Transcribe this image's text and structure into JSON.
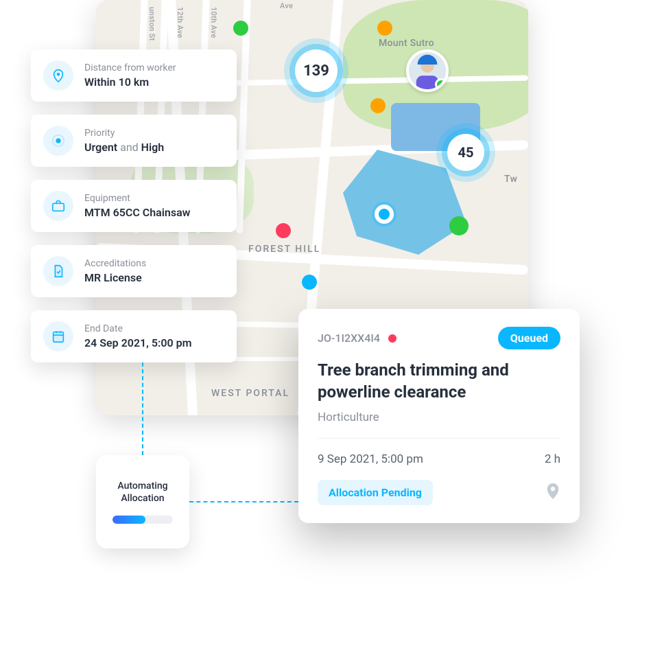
{
  "map": {
    "labels": {
      "sutro": "Mount Sutro",
      "forest_hill": "FOREST HILL",
      "west_portal": "WEST PORTAL",
      "tw": "Tw",
      "tenth": "10th Ave",
      "twelfth": "12th Ave",
      "unston": "unston St",
      "ave": "Ave"
    },
    "clusters": {
      "c139": "139",
      "c45": "45"
    }
  },
  "filters": [
    {
      "label": "Distance from worker",
      "value": "Within 10 km",
      "icon": "map-pin-icon"
    },
    {
      "label": "Priority",
      "value_html": [
        "Urgent",
        " and ",
        "High"
      ],
      "icon": "priority-dot-icon"
    },
    {
      "label": "Equipment",
      "value": "MTM 65CC Chainsaw",
      "icon": "briefcase-icon"
    },
    {
      "label": "Accreditations",
      "value": "MR License",
      "icon": "document-check-icon"
    },
    {
      "label": "End Date",
      "value": "24 Sep 2021, 5:00 pm",
      "icon": "calendar-icon"
    }
  ],
  "automation": {
    "label_line1": "Automating",
    "label_line2": "Allocation"
  },
  "job": {
    "id": "JO-1I2XX4I4",
    "status_badge": "Queued",
    "title": "Tree branch trimming and powerline clearance",
    "category": "Horticulture",
    "datetime": "9 Sep 2021, 5:00 pm",
    "duration": "2 h",
    "allocation_status": "Allocation Pending"
  },
  "colors": {
    "brand_cyan": "#0ab7ff",
    "green": "#2ecc40",
    "orange": "#ffa200",
    "red": "#ff3b5b"
  }
}
